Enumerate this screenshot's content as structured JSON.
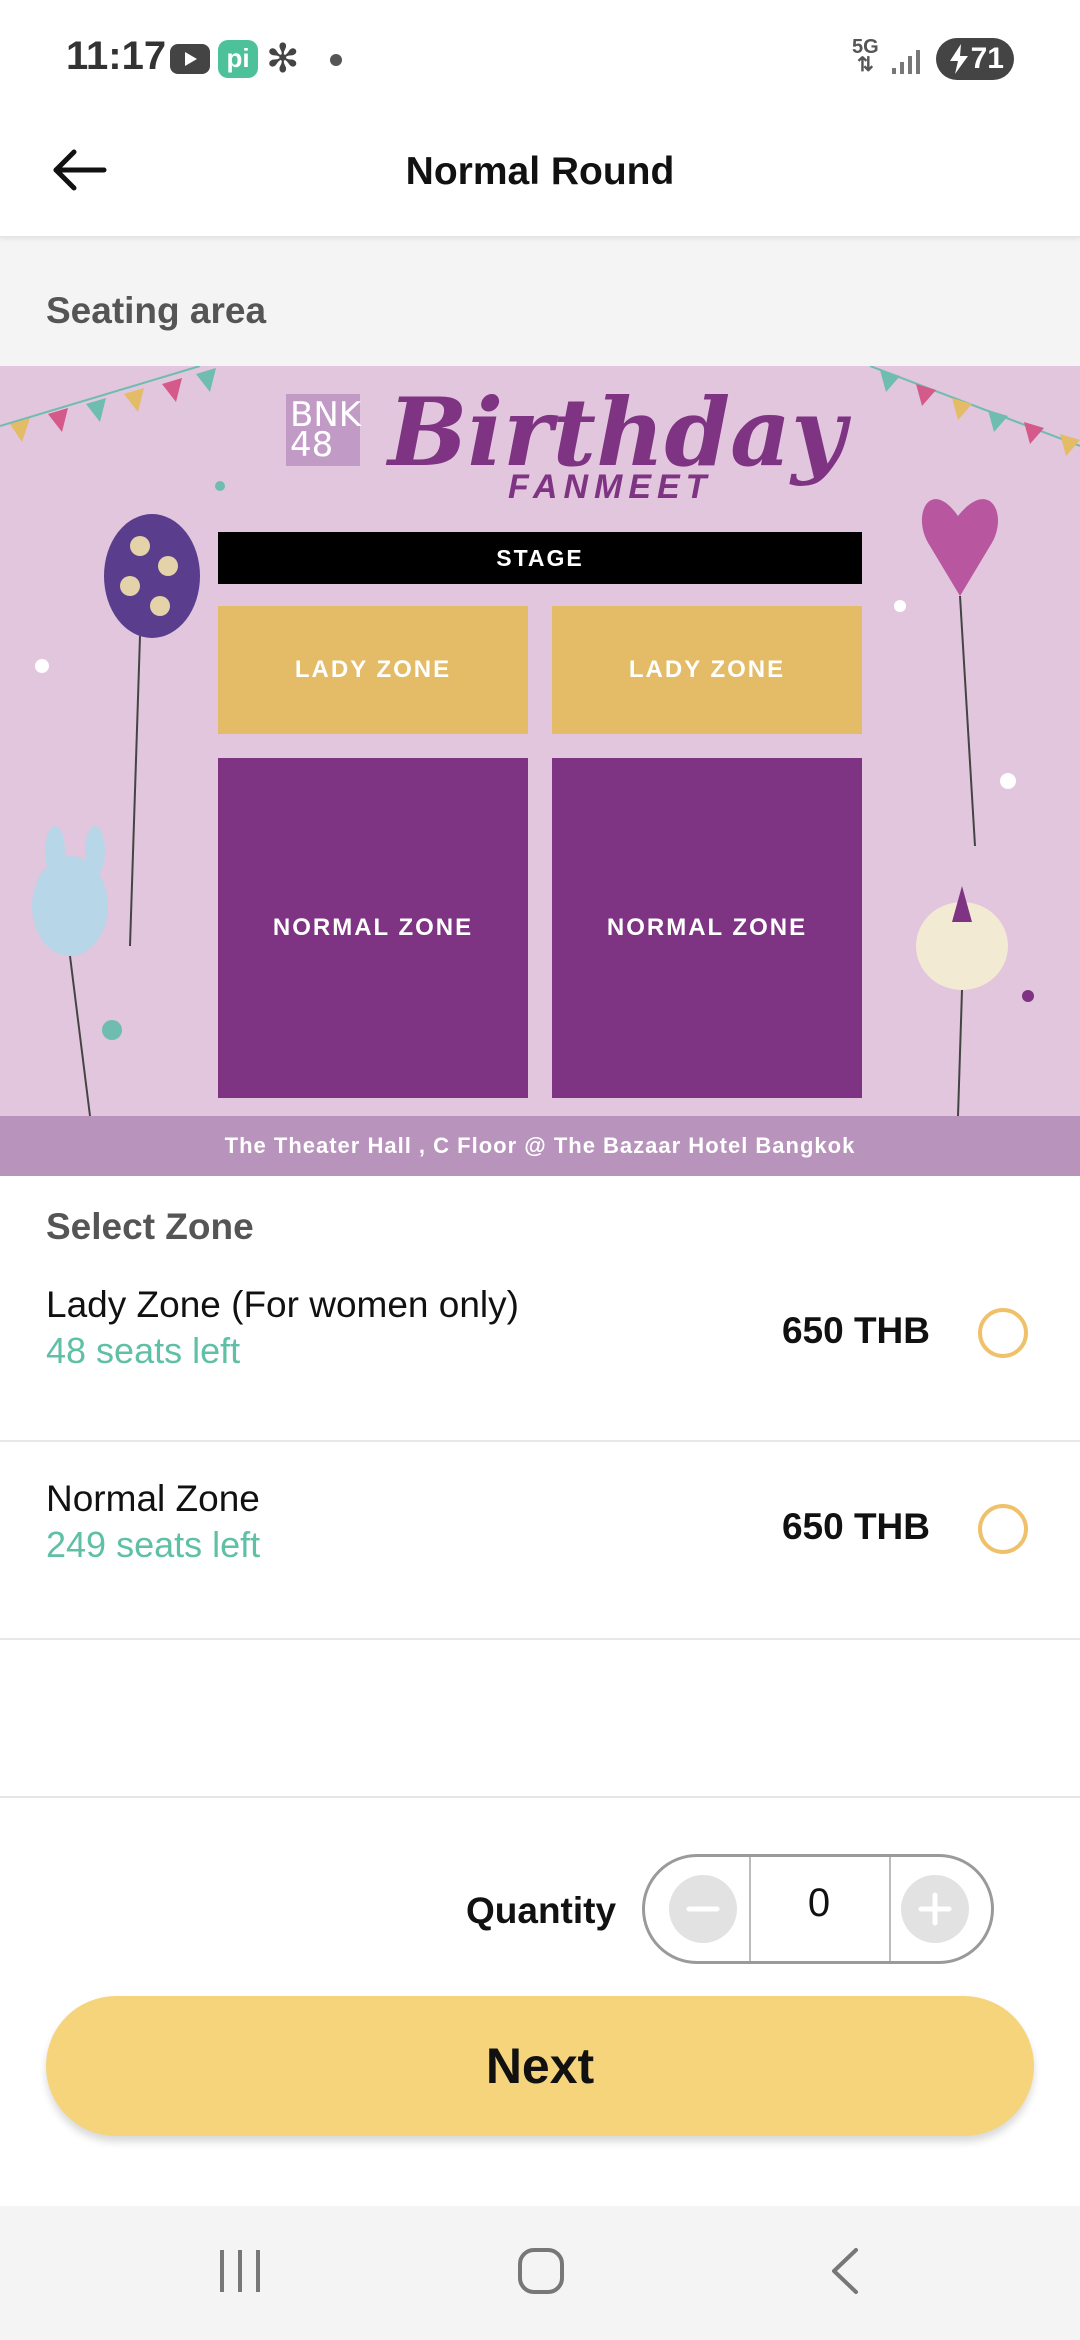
{
  "status_bar": {
    "time": "11:17",
    "network": "5G",
    "battery": "71"
  },
  "header": {
    "title": "Normal Round"
  },
  "seating": {
    "label": "Seating area",
    "banner": {
      "logo_text": "BNK48",
      "title": "Birthday",
      "subtitle": "FANMEET",
      "stage": "STAGE",
      "lady_zone_left": "LADY ZONE",
      "lady_zone_right": "LADY ZONE",
      "normal_zone_left": "NORMAL ZONE",
      "normal_zone_right": "NORMAL ZONE",
      "venue": "The Theater Hall , C Floor @ The Bazaar Hotel Bangkok"
    }
  },
  "zones": {
    "heading": "Select Zone",
    "items": [
      {
        "name": "Lady Zone (For women only)",
        "seats": "48 seats left",
        "price": "650 THB",
        "selected": false
      },
      {
        "name": "Normal Zone",
        "seats": "249 seats left",
        "price": "650 THB",
        "selected": false
      }
    ]
  },
  "purchase": {
    "quantity_label": "Quantity",
    "quantity_value": "0",
    "next_label": "Next"
  },
  "colors": {
    "accent_yellow": "#f5d47c",
    "radio_border": "#f0c16b",
    "seats_green": "#5fc0a6",
    "zone_purple": "#7e3383",
    "zone_gold": "#e4bb66",
    "banner_bg": "#e2c6dd"
  },
  "icons": {
    "back": "arrow-left-icon",
    "minus": "minus-icon",
    "plus": "plus-icon",
    "nav_recent": "recent-apps-icon",
    "nav_home": "home-icon",
    "nav_back": "chevron-left-icon"
  }
}
